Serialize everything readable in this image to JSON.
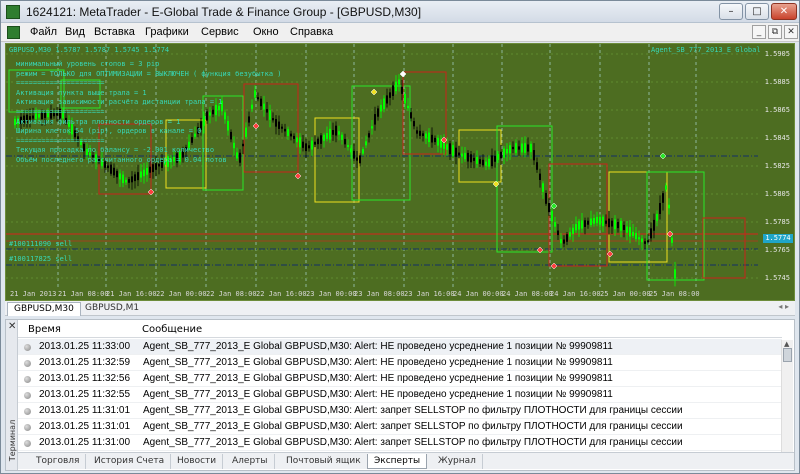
{
  "window": {
    "title": "1624121: MetaTrader - E-Global Trade & Finance Group - [GBPUSD,M30]",
    "minimize": "–",
    "maximize": "□",
    "close": "✕"
  },
  "menu": {
    "items": [
      "Файл",
      "Вид",
      "Вставка",
      "Графики",
      "Сервис",
      "Окно",
      "Справка"
    ],
    "mdi_minimize": "_",
    "mdi_restore": "⧉",
    "mdi_close": "✕"
  },
  "chart": {
    "header": "GBPUSD,M30  1.5787 1.5787 1.5745 1.5774",
    "expert_name": "Agent_SB_777_2013_E Global",
    "info_lines": [
      "минимальный уровень стопов = 3 pip",
      "режим = ТОЛЬКО для ОПТИМИЗАЦИИ = ВЫКЛЮЧЕН ( функция безубытка )",
      "=====================",
      "Активация пункта выше трала = 1",
      "Активация зависимости расчёта дистанции трала = 1",
      "=====================",
      "Активация фильтра плотности ордеров = 1",
      "Ширина клеток 54 (pip), ордеров в канале = 0",
      "=====================",
      "Текущая просадка по балансу = -2.001 количество",
      "Объём последнего рассчитанного ордера = 0.04 лотов"
    ],
    "order_labels": [
      "#100111090 sell",
      "#100117825 sell"
    ],
    "price_ticks": [
      "1.5905",
      "1.5885",
      "1.5865",
      "1.5845",
      "1.5825",
      "1.5805",
      "1.5785",
      "1.5765",
      "1.5745"
    ],
    "current_price": "1.5774",
    "time_ticks": [
      "21 Jan 2013",
      "21 Jan 08:00",
      "21 Jan 16:00",
      "22 Jan 00:00",
      "22 Jan 08:00",
      "22 Jan 16:00",
      "23 Jan 00:00",
      "23 Jan 08:00",
      "23 Jan 16:00",
      "24 Jan 00:00",
      "24 Jan 08:00",
      "24 Jan 16:00",
      "25 Jan 00:00",
      "25 Jan 08:00"
    ],
    "colors": {
      "background": "#4d6d21",
      "bull": "#00ff00",
      "bear": "#000000",
      "text": "#37d8b7",
      "box_red": "#c9221a",
      "box_yellow": "#f0e020",
      "box_green": "#29e829"
    }
  },
  "chart_tabs": {
    "items": [
      "GBPUSD,M30",
      "GBPUSD,M1"
    ]
  },
  "terminal": {
    "side_label": "Терминал",
    "columns": {
      "time": "Время",
      "message": "Сообщение"
    },
    "rows": [
      {
        "time": "2013.01.25 11:33:00",
        "message": "Agent_SB_777_2013_E Global GBPUSD,M30: Alert: НЕ проведено усреднение 1 позиции № 99909811"
      },
      {
        "time": "2013.01.25 11:32:59",
        "message": "Agent_SB_777_2013_E Global GBPUSD,M30: Alert: НЕ проведено усреднение 1 позиции № 99909811"
      },
      {
        "time": "2013.01.25 11:32:56",
        "message": "Agent_SB_777_2013_E Global GBPUSD,M30: Alert: НЕ проведено усреднение 1 позиции № 99909811"
      },
      {
        "time": "2013.01.25 11:32:55",
        "message": "Agent_SB_777_2013_E Global GBPUSD,M30: Alert: НЕ проведено усреднение 1 позиции № 99909811"
      },
      {
        "time": "2013.01.25 11:31:01",
        "message": "Agent_SB_777_2013_E Global GBPUSD,M30: Alert: запрет SELLSTOP по фильтру ПЛОТНОСТИ для границы сессии"
      },
      {
        "time": "2013.01.25 11:31:01",
        "message": "Agent_SB_777_2013_E Global GBPUSD,M30: Alert: запрет SELLSTOP по фильтру ПЛОТНОСТИ для границы сессии"
      },
      {
        "time": "2013.01.25 11:31:00",
        "message": "Agent_SB_777_2013_E Global GBPUSD,M30: Alert: запрет SELLSTOP по фильтру ПЛОТНОСТИ для границы сессии"
      }
    ],
    "tabs": [
      "Торговля",
      "История Счета",
      "Новости",
      "Алерты",
      "Почтовый ящик",
      "Эксперты",
      "Журнал"
    ],
    "active_tab": "Эксперты"
  }
}
